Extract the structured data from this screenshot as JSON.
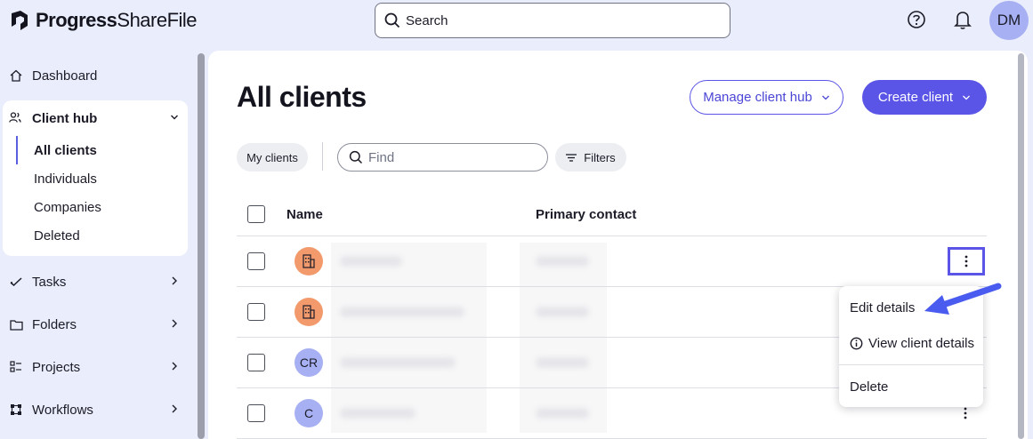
{
  "app": {
    "brand_bold": "Progress",
    "brand_light": "ShareFile"
  },
  "search": {
    "placeholder": "Search"
  },
  "user": {
    "initials": "DM"
  },
  "sidebar": {
    "items": [
      {
        "label": "Dashboard",
        "icon": "home-icon"
      },
      {
        "label": "Client hub",
        "icon": "people-icon",
        "expanded": true,
        "children": [
          "All clients",
          "Individuals",
          "Companies",
          "Deleted"
        ],
        "active_child": "All clients"
      },
      {
        "label": "Tasks",
        "icon": "check-icon"
      },
      {
        "label": "Folders",
        "icon": "folder-icon"
      },
      {
        "label": "Projects",
        "icon": "projects-icon"
      },
      {
        "label": "Workflows",
        "icon": "workflow-icon"
      }
    ]
  },
  "main": {
    "title": "All clients",
    "manage_button": "Manage client hub",
    "create_button": "Create client",
    "my_clients_chip": "My clients",
    "find_placeholder": "Find",
    "filters_chip": "Filters",
    "columns": [
      "Name",
      "Primary contact"
    ],
    "rows": [
      {
        "avatar_type": "company",
        "initials": ""
      },
      {
        "avatar_type": "company",
        "initials": ""
      },
      {
        "avatar_type": "person",
        "initials": "CR"
      },
      {
        "avatar_type": "person",
        "initials": "C"
      }
    ]
  },
  "context_menu": {
    "items": [
      "Edit details",
      "View client details",
      "Delete"
    ]
  },
  "colors": {
    "accent": "#5a55e6",
    "company_avatar": "#f39a6d",
    "person_avatar": "#a6b0f3",
    "background": "#eaedfb"
  }
}
